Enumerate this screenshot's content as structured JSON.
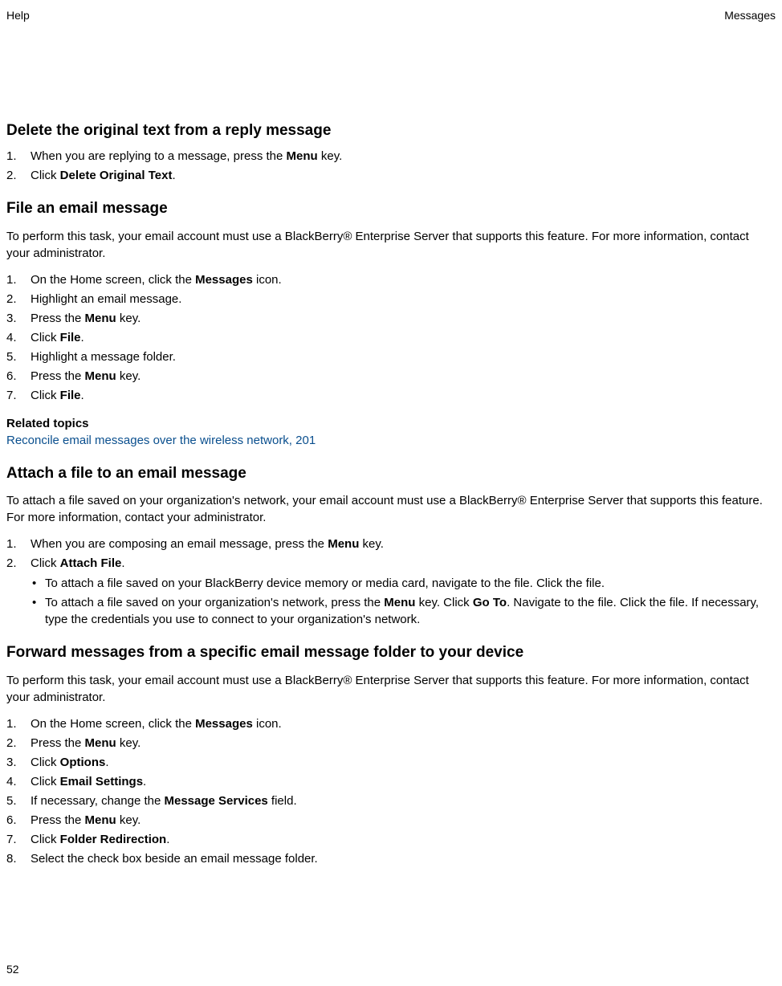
{
  "header": {
    "left": "Help",
    "right": "Messages"
  },
  "page_number": "52",
  "sections": {
    "s1": {
      "title": "Delete the original text from a reply message",
      "step1_pre": "When you are replying to a message, press the ",
      "step1_bold": "Menu",
      "step1_post": " key.",
      "step2_pre": "Click ",
      "step2_bold": "Delete Original Text",
      "step2_post": "."
    },
    "s2": {
      "title": "File an email message",
      "intro": "To perform this task, your email account must use a BlackBerry® Enterprise Server that supports this feature. For more information, contact your administrator.",
      "step1_pre": "On the Home screen, click the ",
      "step1_bold": "Messages",
      "step1_post": " icon.",
      "step2": "Highlight an email message.",
      "step3_pre": "Press the ",
      "step3_bold": "Menu",
      "step3_post": " key.",
      "step4_pre": "Click ",
      "step4_bold": "File",
      "step4_post": ".",
      "step5": "Highlight a message folder.",
      "step6_pre": "Press the ",
      "step6_bold": "Menu",
      "step6_post": " key.",
      "step7_pre": "Click ",
      "step7_bold": "File",
      "step7_post": ".",
      "related_heading": "Related topics",
      "related_link": "Reconcile email messages over the wireless network, 201"
    },
    "s3": {
      "title": "Attach a file to an email message",
      "intro": "To attach a file saved on your organization's network, your email account must use a BlackBerry® Enterprise Server that supports this feature. For more information, contact your administrator.",
      "step1_pre": "When you are composing an email message, press the ",
      "step1_bold": "Menu",
      "step1_post": " key.",
      "step2_pre": "Click ",
      "step2_bold": "Attach File",
      "step2_post": ".",
      "bullet1": "To attach a file saved on your BlackBerry device memory or media card, navigate to the file. Click the file.",
      "bullet2_p1": "To attach a file saved on your organization's network, press the ",
      "bullet2_b1": "Menu",
      "bullet2_p2": " key. Click ",
      "bullet2_b2": "Go To",
      "bullet2_p3": ". Navigate to the file. Click the file. If necessary, type the credentials you use to connect to your organization's network."
    },
    "s4": {
      "title": "Forward messages from a specific email message folder to your device",
      "intro": "To perform this task, your email account must use a BlackBerry® Enterprise Server that supports this feature. For more information, contact your administrator.",
      "step1_pre": "On the Home screen, click the ",
      "step1_bold": "Messages",
      "step1_post": " icon.",
      "step2_pre": "Press the ",
      "step2_bold": "Menu",
      "step2_post": " key.",
      "step3_pre": "Click ",
      "step3_bold": "Options",
      "step3_post": ".",
      "step4_pre": "Click ",
      "step4_bold": "Email Settings",
      "step4_post": ".",
      "step5_pre": "If necessary, change the ",
      "step5_bold": "Message Services",
      "step5_post": " field.",
      "step6_pre": "Press the ",
      "step6_bold": "Menu",
      "step6_post": " key.",
      "step7_pre": "Click ",
      "step7_bold": "Folder Redirection",
      "step7_post": ".",
      "step8": "Select the check box beside an email message folder."
    }
  }
}
